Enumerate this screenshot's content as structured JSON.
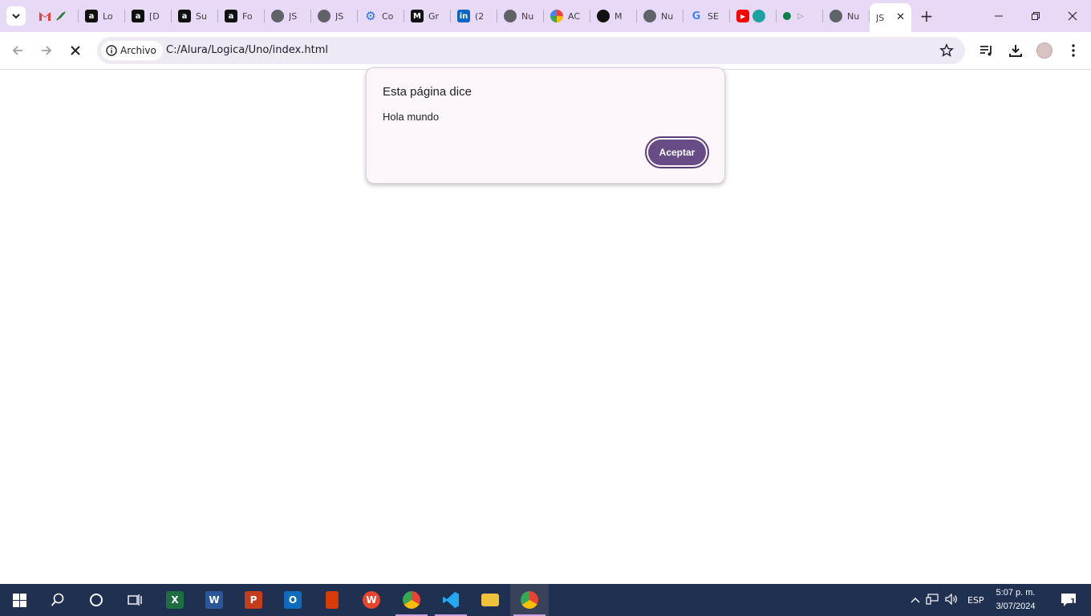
{
  "browser": {
    "tabs": [
      {
        "title": "",
        "icon": "gmail-icon"
      },
      {
        "title": "Lo",
        "icon": "alura-icon"
      },
      {
        "title": "[D",
        "icon": "alura-icon"
      },
      {
        "title": "Su",
        "icon": "alura-icon"
      },
      {
        "title": "Fo",
        "icon": "alura-icon"
      },
      {
        "title": "JS",
        "icon": "globe-icon"
      },
      {
        "title": "JS",
        "icon": "globe-icon"
      },
      {
        "title": "Co",
        "icon": "gear-icon"
      },
      {
        "title": "Gr",
        "icon": "medium-icon"
      },
      {
        "title": "(2",
        "icon": "linkedin-icon"
      },
      {
        "title": "Nu",
        "icon": "chrome-icon"
      },
      {
        "title": "AC",
        "icon": "photos-icon"
      },
      {
        "title": "M",
        "icon": "github-icon"
      },
      {
        "title": "Nu",
        "icon": "chrome-icon"
      },
      {
        "title": "SE",
        "icon": "google-icon"
      },
      {
        "title": "",
        "icon": "youtube-icon"
      },
      {
        "title": "",
        "icon": "extension-icon"
      },
      {
        "title": "Nu",
        "icon": "chrome-icon"
      },
      {
        "title": "JS",
        "icon": "blank-icon",
        "active": true
      }
    ],
    "security_chip": "Archivo",
    "url": "C:/Alura/Logica/Uno/index.html"
  },
  "dialog": {
    "title": "Esta página dice",
    "message": "Hola mundo",
    "button_label": "Aceptar"
  },
  "taskbar": {
    "apps": [
      "start",
      "search",
      "cortana",
      "task-view",
      "excel",
      "word",
      "powerpoint",
      "outlook",
      "office",
      "wps",
      "chrome",
      "vscode",
      "file-explorer",
      "chrome-profile"
    ],
    "language": "ESP",
    "time": "5:07 p. m.",
    "date": "3/07/2024",
    "notification_count": "1"
  }
}
